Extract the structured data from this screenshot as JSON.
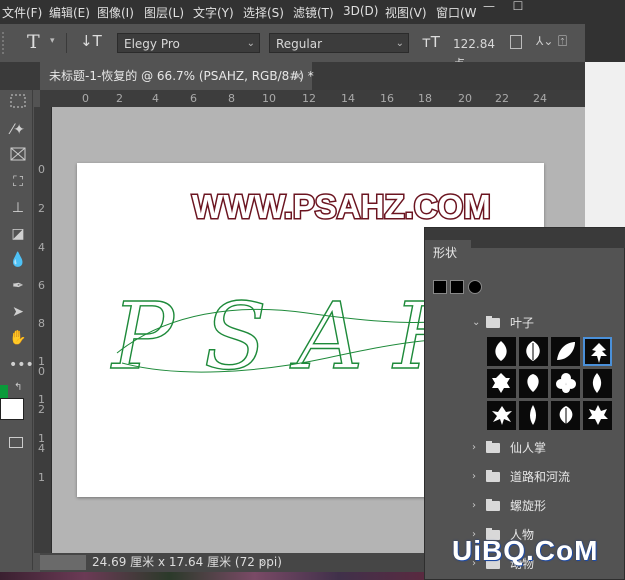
{
  "menu": [
    "文件(F)",
    "编辑(E)",
    "图像(I)",
    "图层(L)",
    "文字(Y)",
    "选择(S)",
    "滤镜(T)",
    "3D(D)",
    "视图(V)",
    "窗口(W"
  ],
  "window_controls": [
    "—",
    "☐"
  ],
  "options": {
    "tool_icon": "T",
    "font_family": "Elegy Pro",
    "font_style": "Regular",
    "font_size": "122.84 点"
  },
  "document_tab": {
    "title": "未标题-1-恢复的 @ 66.7% (PSAHZ, RGB/8#) *",
    "close": "×"
  },
  "ruler": {
    "horizontal": [
      "0",
      "2",
      "4",
      "6",
      "8",
      "10",
      "12",
      "14",
      "16",
      "18",
      "20",
      "22",
      "24"
    ],
    "vertical": [
      "0",
      "2",
      "4",
      "6",
      "8",
      "1",
      "0",
      "1",
      "2",
      "1",
      "4",
      "1"
    ]
  },
  "canvas": {
    "heading": "WWW.PSAHZ.COM",
    "script_text": "PSAH"
  },
  "status": {
    "dimensions": "24.69 厘米 x 17.64 厘米 (72 ppi)",
    "arrow": "›"
  },
  "shapes_panel": {
    "tab": "形状",
    "folders": [
      {
        "label": "叶子",
        "expanded": true
      },
      {
        "label": "仙人掌",
        "expanded": false
      },
      {
        "label": "道路和河流",
        "expanded": false
      },
      {
        "label": "螺旋形",
        "expanded": false
      },
      {
        "label": "人物",
        "expanded": false
      },
      {
        "label": "动物",
        "expanded": false
      }
    ]
  },
  "colors": {
    "menubar": "#323232",
    "workspace": "#535353",
    "heading_fill": "#ffffff",
    "heading_stroke": "#6b1420",
    "script_green": "#1e8a3a",
    "foreground": "#0a9a3a",
    "background": "#ffffff",
    "selection": "#4a90d9"
  }
}
